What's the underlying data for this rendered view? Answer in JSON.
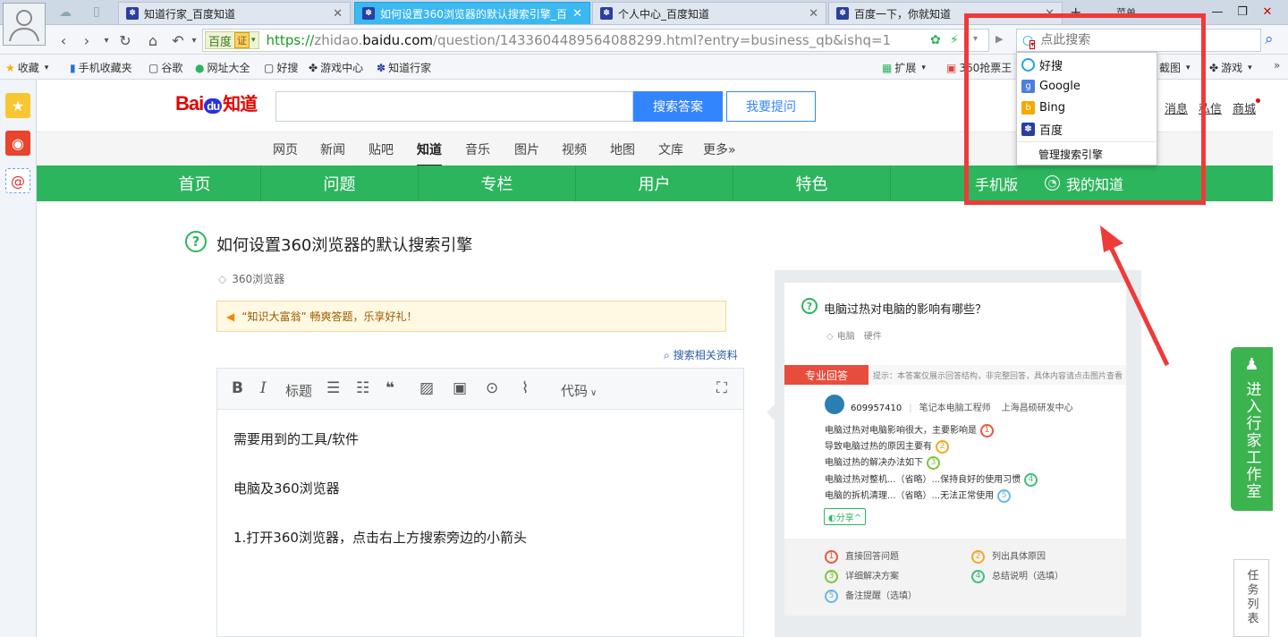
{
  "tabs": [
    {
      "title": "知道行家_百度知道"
    },
    {
      "title": "如何设置360浏览器的默认搜索引擎_百"
    },
    {
      "title": "个人中心_百度知道"
    },
    {
      "title": "百度一下，你就知道"
    }
  ],
  "tabbar_extra": "菜单",
  "nav": {
    "engine_badge": "百度",
    "cert_label": "证",
    "url_proto": "https://",
    "url_pre": "zhidao.",
    "url_host": "baidu.com",
    "url_path": "/question/1433604489564088299.html?entry=business_qb&ishq=1",
    "search_placeholder": "点此搜索"
  },
  "bookmarks": [
    "收藏",
    "手机收藏夹",
    "谷歌",
    "网址大全",
    "好搜",
    "游戏中心",
    "知道行家"
  ],
  "bookmarks_right": [
    "扩展",
    "360抢票王",
    "截图",
    "游戏"
  ],
  "header": {
    "search_button": "搜索答案",
    "ask_button": "我要提问",
    "links": [
      "消息",
      "私信",
      "商城"
    ]
  },
  "subnav": [
    "网页",
    "新闻",
    "贴吧",
    "知道",
    "音乐",
    "图片",
    "视频",
    "地图",
    "文库",
    "更多»"
  ],
  "greennav": [
    "首页",
    "问题",
    "专栏",
    "用户",
    "特色",
    "手机版",
    "我的知道"
  ],
  "question": {
    "title": "如何设置360浏览器的默认搜索引擎",
    "tag": "360浏览器",
    "notice": "“知识大富翁” 畅爽答题，乐享好礼！",
    "related": "搜索相关资料"
  },
  "editor": {
    "toolbar": {
      "bold": "B",
      "italic": "I",
      "heading": "标题",
      "code": "代码"
    },
    "lines": [
      "需要用到的工具/软件",
      "电脑及360浏览器",
      "1.打开360浏览器，点击右上方搜索旁边的小箭头"
    ]
  },
  "sample": {
    "question": "电脑过热对电脑的影响有哪些？",
    "tags": [
      "电脑",
      "硬件"
    ],
    "pro_label": "专业回答",
    "pro_hint": "提示：本答案仅展示回答结构，非完整回答，具体内容请点击图片查看",
    "user": "609957410",
    "role": "笔记本电脑工程师",
    "org": "上海昌硕研发中心",
    "lines": [
      "电脑过热对电脑影响很大，主要影响是",
      "导致电脑过热的原因主要有",
      "电脑过热的解决办法如下",
      "电脑过热对整机...（省略）...保持良好的使用习惯",
      "电脑的拆机清理...（省略）...无法正常使用"
    ],
    "share": "分享",
    "legend": [
      "直接回答问题",
      "列出具体原因",
      "详细解决方案",
      "总结说明（选填）",
      "备注提醒（选填）"
    ]
  },
  "side": {
    "workroom": "进入行家工作室",
    "tasklist": "任务列表"
  },
  "dropdown": {
    "items": [
      "好搜",
      "Google",
      "Bing",
      "百度"
    ],
    "manage": "管理搜索引擎"
  },
  "colors": {
    "accent": "#3385ff",
    "green": "#2db55d",
    "highlight": "#ef3a3a",
    "tab_active": "#3cb8f0"
  }
}
